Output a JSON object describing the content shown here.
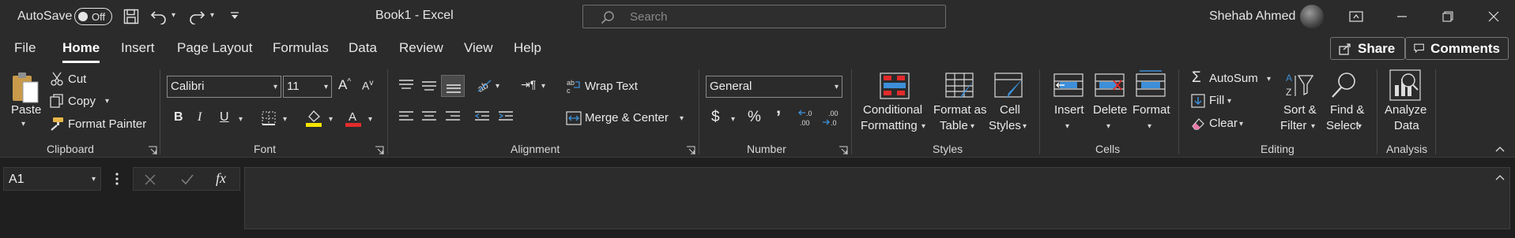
{
  "titlebar": {
    "autosave_label": "AutoSave",
    "autosave_state": "Off",
    "document_title": "Book1  -  Excel",
    "search_placeholder": "Search",
    "user_name": "Shehab Ahmed"
  },
  "tabs": [
    "File",
    "Home",
    "Insert",
    "Page Layout",
    "Formulas",
    "Data",
    "Review",
    "View",
    "Help"
  ],
  "active_tab": "Home",
  "share_label": "Share",
  "comments_label": "Comments",
  "clipboard": {
    "paste": "Paste",
    "cut": "Cut",
    "copy": "Copy",
    "format_painter": "Format Painter",
    "label": "Clipboard"
  },
  "font": {
    "name": "Calibri",
    "size": "11",
    "label": "Font"
  },
  "alignment": {
    "wrap_text": "Wrap Text",
    "merge_center": "Merge & Center",
    "label": "Alignment"
  },
  "number": {
    "format": "General",
    "label": "Number"
  },
  "styles": {
    "conditional_1": "Conditional",
    "conditional_2": "Formatting",
    "format_table_1": "Format as",
    "format_table_2": "Table",
    "cell_styles_1": "Cell",
    "cell_styles_2": "Styles",
    "label": "Styles"
  },
  "cells": {
    "insert": "Insert",
    "delete": "Delete",
    "format": "Format",
    "label": "Cells"
  },
  "editing": {
    "autosum": "AutoSum",
    "fill": "Fill",
    "clear": "Clear",
    "sort_1": "Sort &",
    "sort_2": "Filter",
    "find_1": "Find &",
    "find_2": "Select",
    "label": "Editing"
  },
  "analysis": {
    "analyze_1": "Analyze",
    "analyze_2": "Data",
    "label": "Analysis"
  },
  "formula_bar": {
    "name_box": "A1",
    "fx": "fx",
    "formula_value": ""
  },
  "colors": {
    "background": "#1f1f1f",
    "ribbon": "#2b2b2b",
    "highlight_yellow": "#f5e400",
    "font_red": "#e32b2b",
    "accent_blue": "#3c8fd8"
  }
}
